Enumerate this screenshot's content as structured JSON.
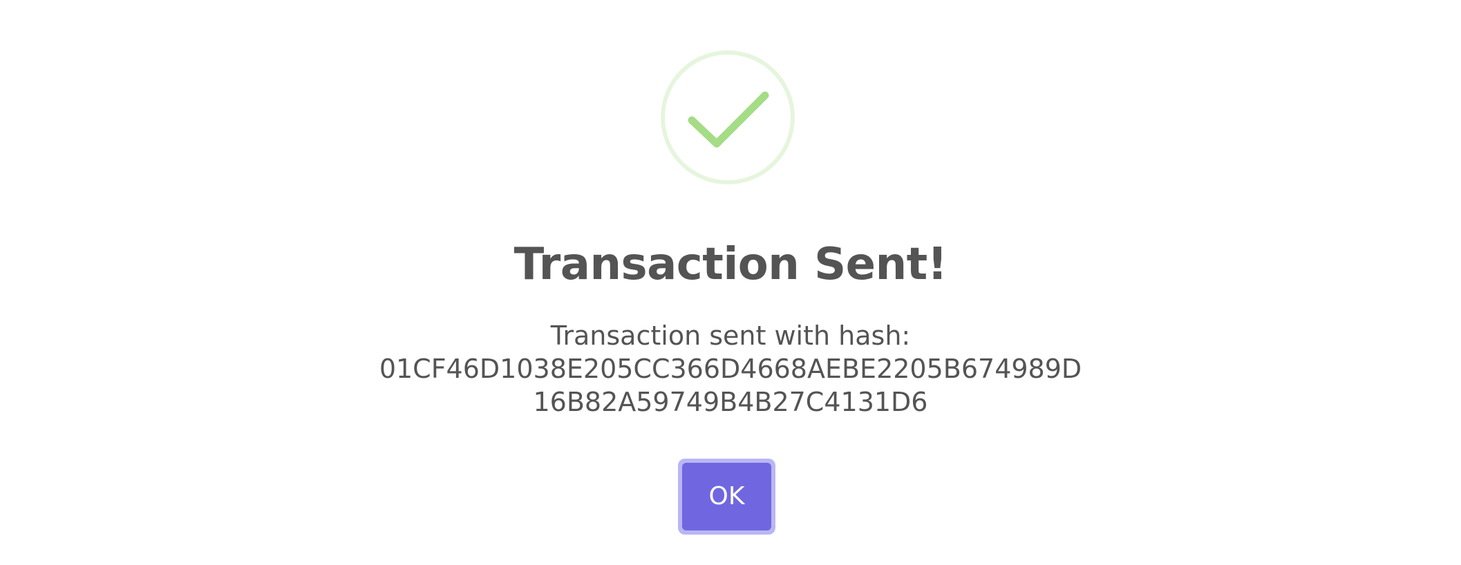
{
  "dialog": {
    "icon": "checkmark-success-icon",
    "title": "Transaction Sent!",
    "message_prefix": "Transaction sent with hash:",
    "hash": "01CF46D1038E205CC366D4668AEBE2205B674989D16B82A59749B4B27C4131D6",
    "ok_label": "OK"
  },
  "colors": {
    "success_green": "#a5dc86",
    "success_ring": "#e6f5dd",
    "button": "#7067e0",
    "button_focus_ring": "#b9b6f4",
    "text": "#545454"
  }
}
